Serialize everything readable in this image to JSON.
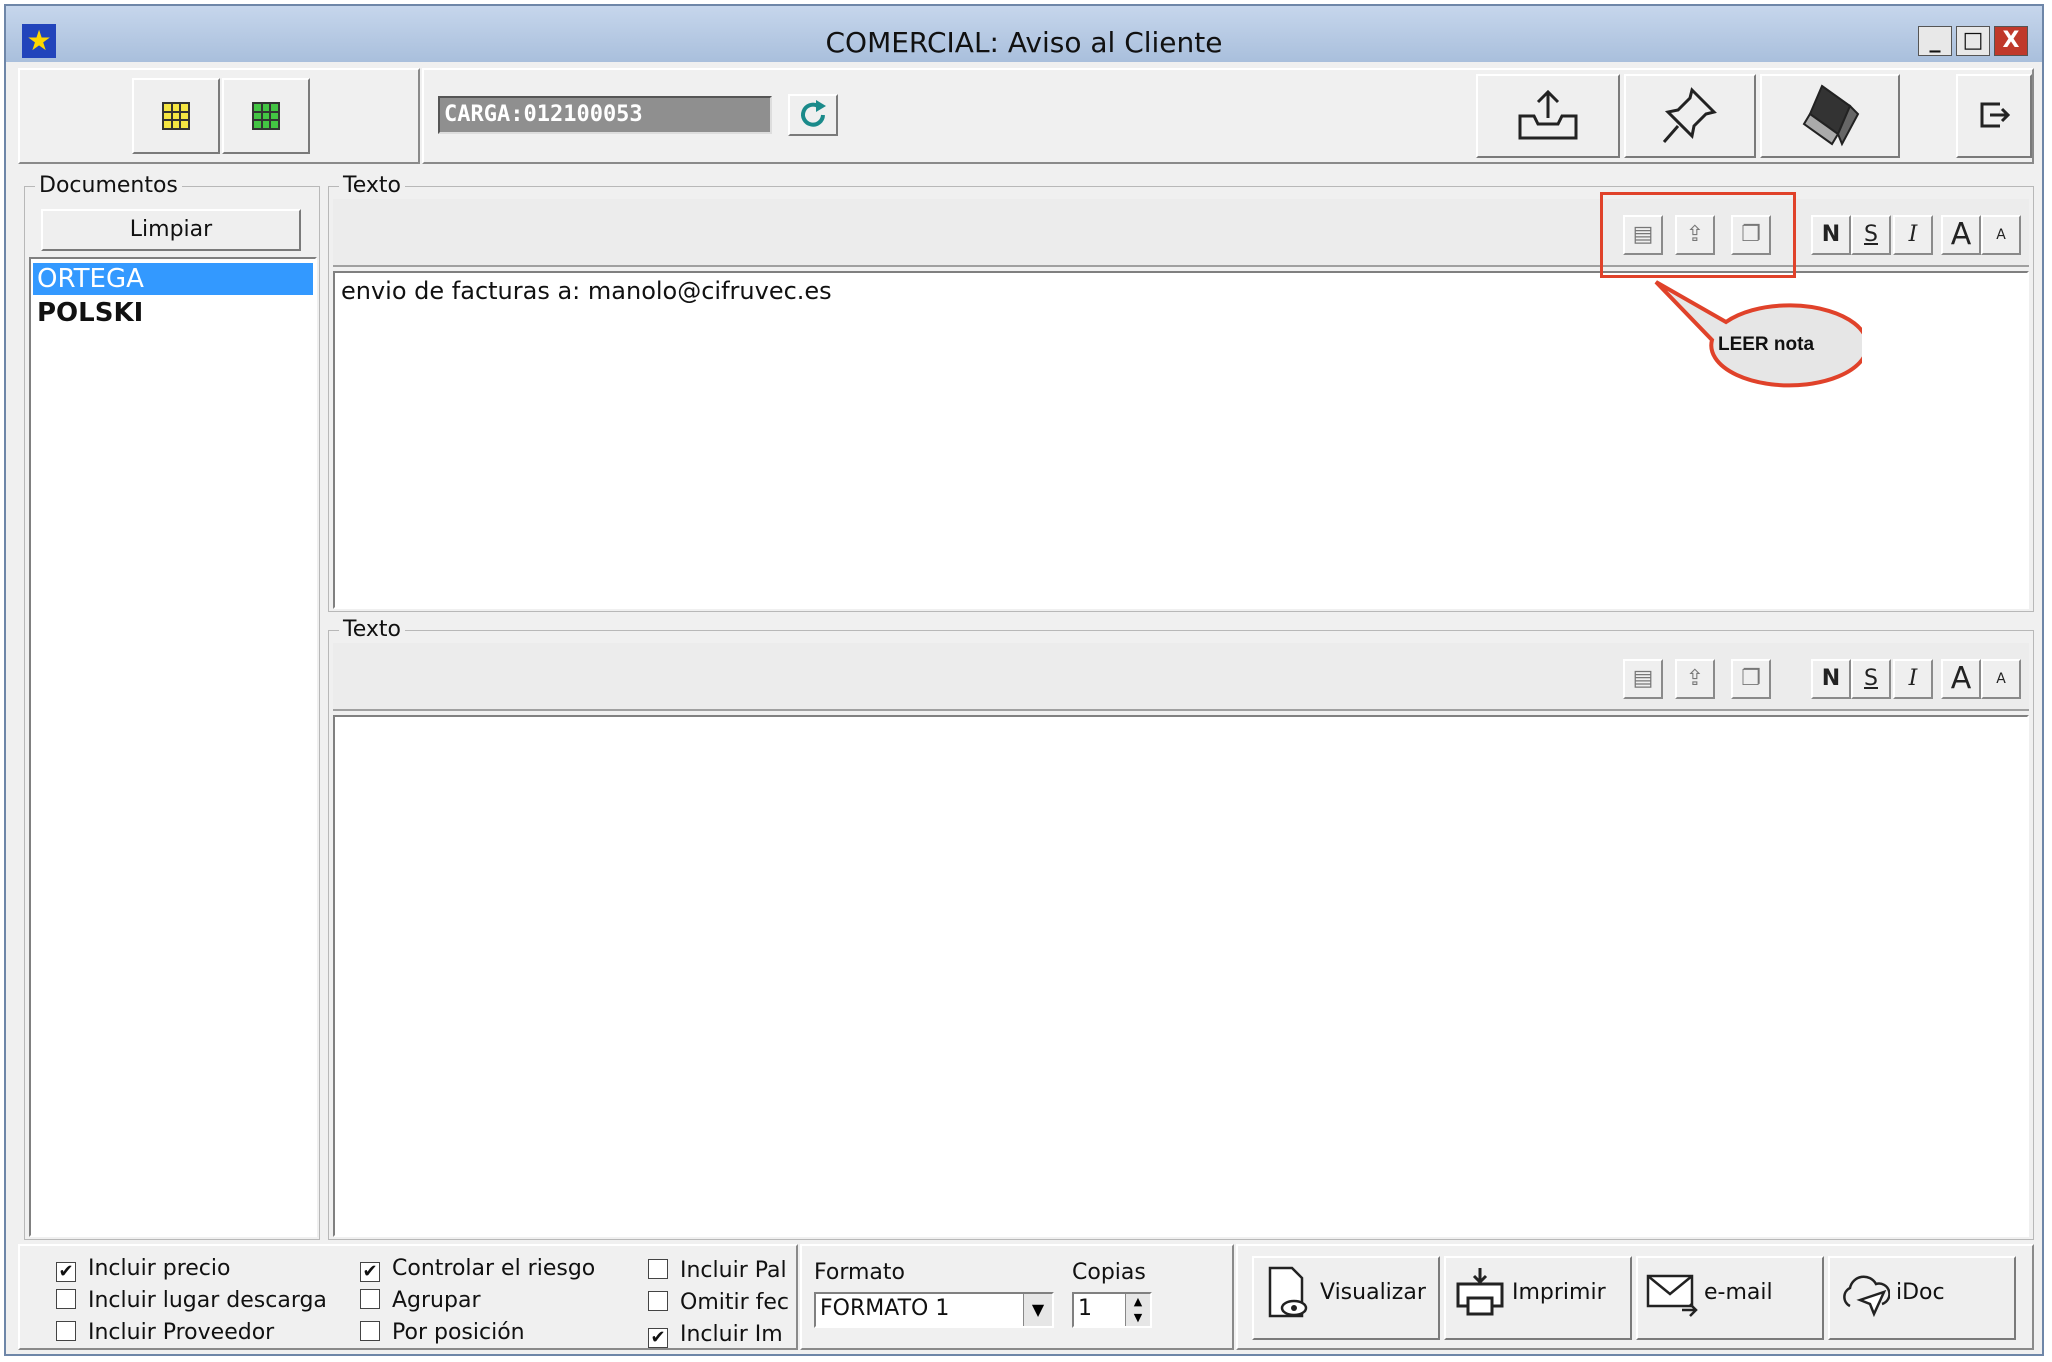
{
  "window": {
    "title": "COMERCIAL: Aviso al Cliente",
    "minimize_label": "_",
    "maximize_label": "□",
    "close_label": "X"
  },
  "toolbar": {
    "carga_value": "CARGA:012100053"
  },
  "documents": {
    "group_label": "Documentos",
    "clear_label": "Limpiar",
    "items": [
      {
        "label": "ORTEGA",
        "selected": true
      },
      {
        "label": "POLSKI",
        "selected": false
      }
    ]
  },
  "text_top": {
    "group_label": "Texto",
    "content": "envio de facturas a: manolo@cifruvec.es",
    "bold_label": "N",
    "underline_label": "S",
    "italic_label": "I",
    "font_big_label": "A",
    "font_small_label": "A"
  },
  "text_bottom": {
    "group_label": "Texto",
    "content": "",
    "bold_label": "N",
    "underline_label": "S",
    "italic_label": "I",
    "font_big_label": "A",
    "font_small_label": "A"
  },
  "callout": {
    "label": "LEER nota",
    "color": "#e0422a"
  },
  "options": {
    "col1": [
      {
        "label": "Incluir precio",
        "checked": true
      },
      {
        "label": "Incluir lugar descarga",
        "checked": false
      },
      {
        "label": "Incluir Proveedor",
        "checked": false
      }
    ],
    "col2": [
      {
        "label": "Controlar el riesgo",
        "checked": true
      },
      {
        "label": "Agrupar",
        "checked": false
      },
      {
        "label": "Por posición",
        "checked": false
      }
    ],
    "col3": [
      {
        "label": "Incluir Pal",
        "checked": false
      },
      {
        "label": "Omitir fec",
        "checked": false
      },
      {
        "label": "Incluir Im",
        "checked": true
      }
    ]
  },
  "format": {
    "format_label": "Formato",
    "format_value": "FORMATO 1",
    "copies_label": "Copias",
    "copies_value": "1"
  },
  "actions": {
    "view_label": "Visualizar",
    "print_label": "Imprimir",
    "email_label": "e-mail",
    "idoc_label": "iDoc"
  },
  "colors": {
    "selection": "#3399ff",
    "titlebar": "#b6c9e3"
  }
}
